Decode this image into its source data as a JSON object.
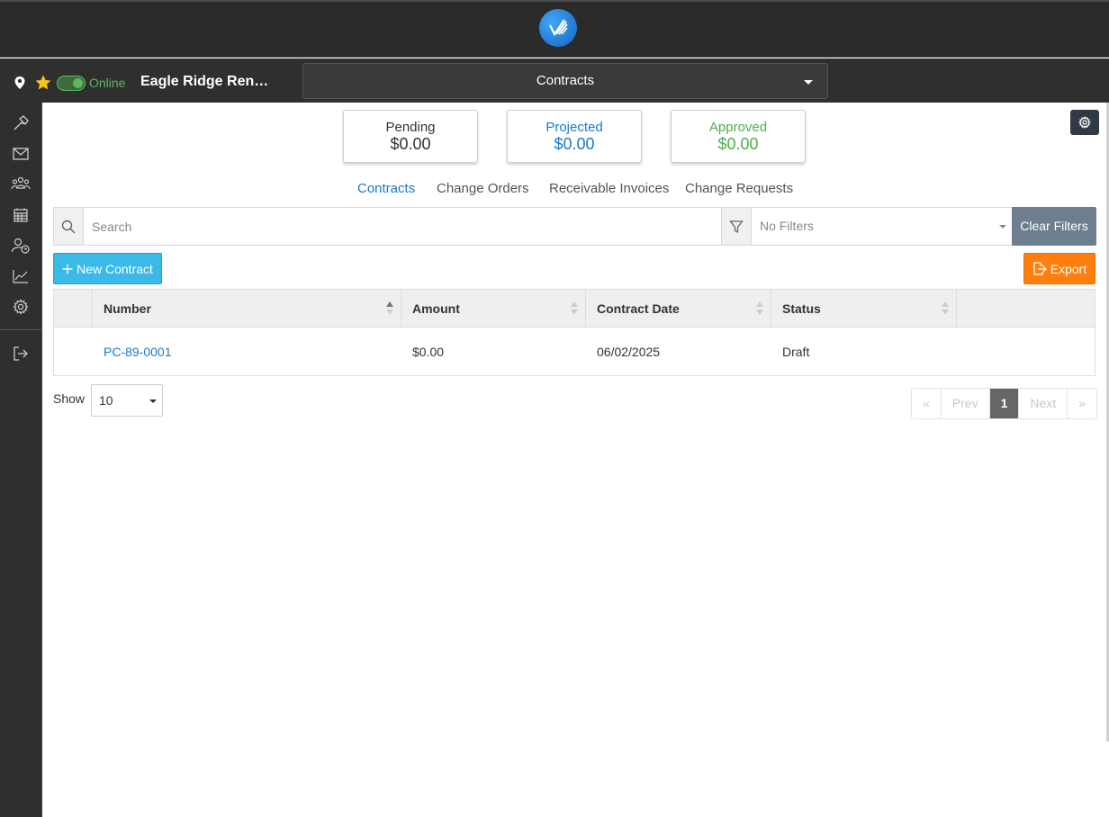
{
  "header": {
    "logo_icon": "app-logo-icon"
  },
  "subbar": {
    "status": "Online",
    "project_name": "Eagle Ridge Ren…",
    "module": "Contracts"
  },
  "sidebar": {
    "items": [
      {
        "name": "hammer-icon"
      },
      {
        "name": "mail-icon"
      },
      {
        "name": "team-icon"
      },
      {
        "name": "calendar-icon"
      },
      {
        "name": "user-clock-icon"
      },
      {
        "name": "chart-icon"
      },
      {
        "name": "gear-icon"
      },
      {
        "name": "logout-icon"
      }
    ]
  },
  "cards": [
    {
      "label": "Pending",
      "value": "$0.00",
      "color": "#333333"
    },
    {
      "label": "Projected",
      "value": "$0.00",
      "color": "#1a7ac8"
    },
    {
      "label": "Approved",
      "value": "$0.00",
      "color": "#4cae4c"
    }
  ],
  "tabs": [
    {
      "label": "Contracts",
      "active": true
    },
    {
      "label": "Change Orders",
      "active": false
    },
    {
      "label": "Receivable Invoices",
      "active": false
    },
    {
      "label": "Change Requests",
      "active": false
    }
  ],
  "search": {
    "placeholder": "Search",
    "filter_value": "No Filters",
    "clear_label": "Clear Filters"
  },
  "actions": {
    "new_label": "New Contract",
    "export_label": "Export"
  },
  "table": {
    "columns": [
      "Number",
      "Amount",
      "Contract Date",
      "Status"
    ],
    "rows": [
      {
        "number": "PC-89-0001",
        "amount": "$0.00",
        "date": "06/02/2025",
        "status": "Draft"
      }
    ]
  },
  "footer": {
    "show_label": "Show",
    "page_size": "10",
    "pager": {
      "first": "«",
      "prev": "Prev",
      "current": "1",
      "next": "Next",
      "last": "»"
    }
  },
  "colors": {
    "accent": "#1a7ac8",
    "new_button": "#3bb9e8",
    "export_button": "#ff7f0e",
    "online": "#5cb85c"
  }
}
